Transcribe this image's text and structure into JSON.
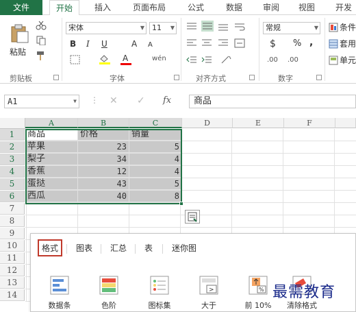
{
  "menu": {
    "file": "文件",
    "tabs": [
      "开始",
      "插入",
      "页面布局",
      "公式",
      "数据",
      "审阅",
      "视图",
      "开发"
    ]
  },
  "ribbon": {
    "paste": "粘贴",
    "font_name": "宋体",
    "font_size": "11",
    "bold": "B",
    "italic": "I",
    "underline": "U",
    "grow_font": "A",
    "shrink_font": "A",
    "phonetic": "wén",
    "number_format": "常规",
    "currency": "$",
    "percent": "%",
    "comma": ",",
    "inc_decimal": ".00",
    "dec_decimal": ".00",
    "conditional_format": "条件",
    "format_as_table": "套用",
    "cell_styles": "单元",
    "groups": [
      "剪贴板",
      "字体",
      "对齐方式",
      "数字"
    ]
  },
  "formula_bar": {
    "name_box": "A1",
    "cancel": "✕",
    "enter": "✓",
    "fx": "fx",
    "content": "商品"
  },
  "sheet": {
    "columns": [
      "A",
      "B",
      "C",
      "D",
      "E",
      "F"
    ],
    "rows": [
      "1",
      "2",
      "3",
      "4",
      "5",
      "6",
      "7",
      "8",
      "9",
      "10",
      "11",
      "12",
      "13",
      "14"
    ],
    "header": [
      "商品",
      "价格",
      "销量"
    ],
    "data": [
      [
        "苹果",
        "23",
        "5"
      ],
      [
        "梨子",
        "34",
        "4"
      ],
      [
        "香蕉",
        "12",
        "4"
      ],
      [
        "蛋挞",
        "43",
        "5"
      ],
      [
        "西瓜",
        "40",
        "8"
      ]
    ]
  },
  "quick_analysis": {
    "tabs": [
      "格式",
      "图表",
      "汇总",
      "表",
      "迷你图"
    ],
    "items": [
      "数据条",
      "色阶",
      "图标集",
      "大于",
      "前 10%",
      "清除格式"
    ],
    "greater_than_glyph": ">",
    "top10_glyph": "%"
  },
  "watermark": "最需教育",
  "colors": {
    "excel_green": "#217346",
    "selection_gray": "#c9c9c9",
    "active_tab_border": "#c0392b"
  }
}
